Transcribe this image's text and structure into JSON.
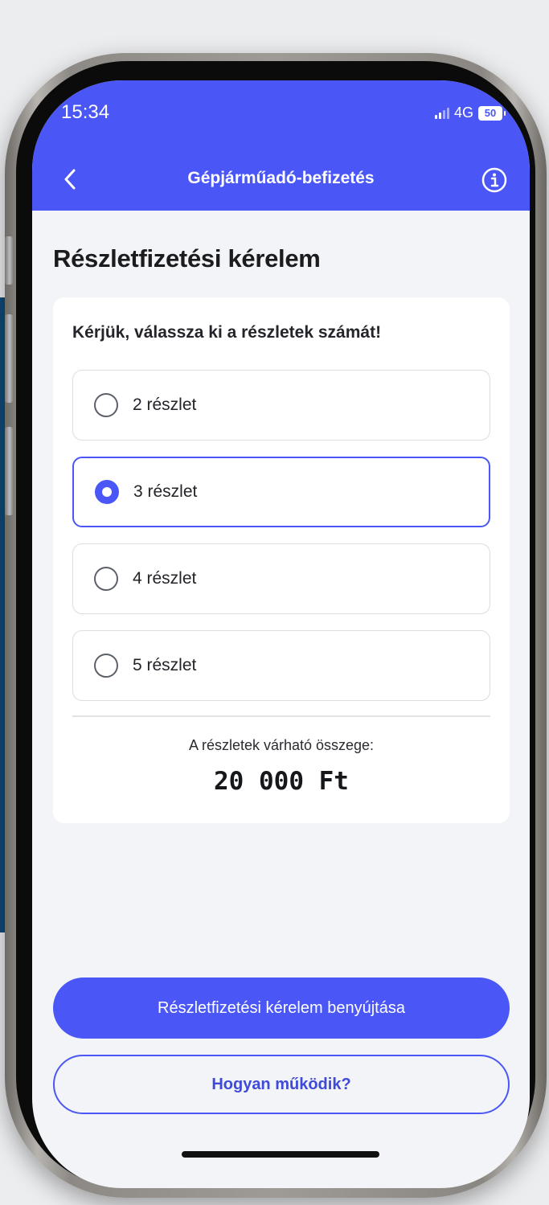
{
  "status_bar": {
    "time": "15:34",
    "network": "4G",
    "battery": "50"
  },
  "nav": {
    "title": "Gépjárműadó-befizetés",
    "back_icon": "chevron-left-icon",
    "info_icon": "info-circle-icon"
  },
  "page": {
    "title": "Részletfizetési kérelem"
  },
  "card": {
    "question": "Kérjük, válassza ki a részletek számát!",
    "options": [
      {
        "label": "2 részlet",
        "selected": false
      },
      {
        "label": "3 részlet",
        "selected": true
      },
      {
        "label": "4 részlet",
        "selected": false
      },
      {
        "label": "5 részlet",
        "selected": false
      }
    ],
    "amount_label": "A részletek várható összege:",
    "amount_value": "20 000 Ft"
  },
  "actions": {
    "primary": "Részletfizetési kérelem benyújtása",
    "secondary": "Hogyan működik?"
  },
  "colors": {
    "accent": "#4a57f6",
    "background": "#f3f4f7"
  }
}
